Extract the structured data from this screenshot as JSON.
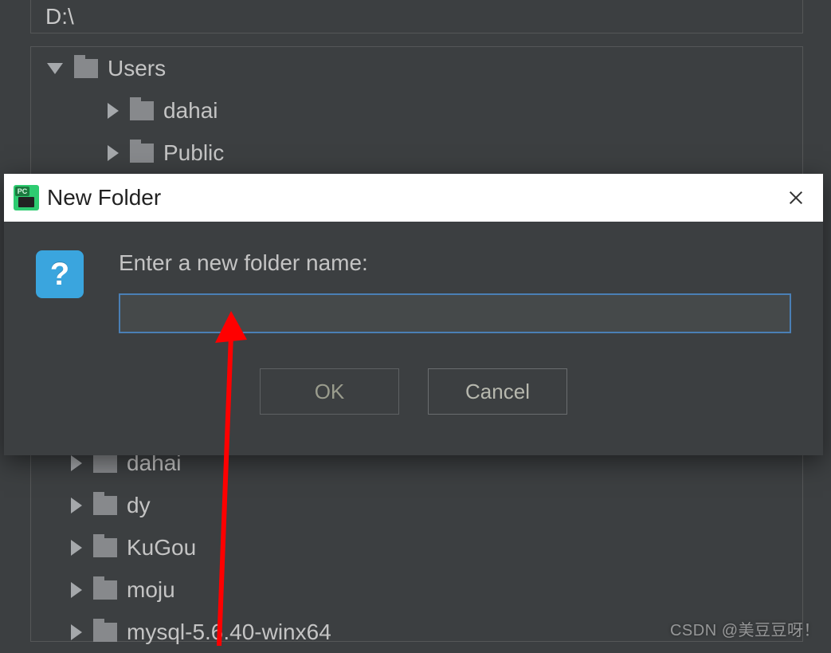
{
  "path_bar": {
    "value": "D:\\"
  },
  "tree": [
    {
      "label": "Users",
      "expanded": true,
      "indent": 20
    },
    {
      "label": "dahai",
      "expanded": false,
      "indent": 96
    },
    {
      "label": "Public",
      "expanded": false,
      "indent": 96
    },
    {
      "label": "dahai",
      "expanded": false,
      "indent": 50
    },
    {
      "label": "dy",
      "expanded": false,
      "indent": 50
    },
    {
      "label": "KuGou",
      "expanded": false,
      "indent": 50
    },
    {
      "label": "moju",
      "expanded": false,
      "indent": 50
    },
    {
      "label": "mysql-5.6.40-winx64",
      "expanded": false,
      "indent": 50
    }
  ],
  "dialog": {
    "title": "New Folder",
    "prompt": "Enter a new folder name:",
    "input_value": "",
    "ok_label": "OK",
    "cancel_label": "Cancel",
    "icon_badge": "PC",
    "question_mark": "?"
  },
  "watermark": "CSDN @美豆豆呀！"
}
